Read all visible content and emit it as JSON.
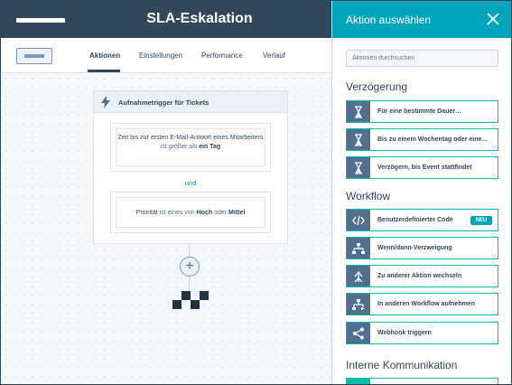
{
  "header": {
    "title": "SLA-Eskalation"
  },
  "tabs": [
    {
      "label": "Aktionen",
      "active": true
    },
    {
      "label": "Einstellungen",
      "active": false
    },
    {
      "label": "Performance",
      "active": false
    },
    {
      "label": "Verlauf",
      "active": false
    }
  ],
  "trigger": {
    "title": "Aufnahmetrigger für Tickets",
    "condition1": {
      "prefix": "Zeit bis zur ersten E-Mail-Antwort eines Mitarbeiters",
      "operator": "ist größer als",
      "value": "ein Tag"
    },
    "connector": "und",
    "condition2": {
      "prefix": "Priorität",
      "operator": "ist eines von",
      "value1": "Hoch",
      "or": "oder",
      "value2": "Mittel"
    }
  },
  "panel": {
    "title": "Aktion auswählen",
    "search_placeholder": "Aktionen durchsuchen",
    "sections": [
      {
        "title": "Verzögerung",
        "items": [
          {
            "label": "Für eine bestimmte Dauer…",
            "icon": "hourglass-icon"
          },
          {
            "label": "Bis zu einem Wochentag oder eine…",
            "icon": "hourglass-icon"
          },
          {
            "label": "Verzögern, bis Event stattfindet",
            "icon": "hourglass-icon"
          }
        ]
      },
      {
        "title": "Workflow",
        "items": [
          {
            "label": "Benutzerdefinierter Code",
            "icon": "code-icon",
            "badge": "NEU"
          },
          {
            "label": "Wenn/dann-Verzweigung",
            "icon": "branch-icon"
          },
          {
            "label": "Zu anderer Aktion wechseln",
            "icon": "goto-icon"
          },
          {
            "label": "In anderen Workflow aufnehmen",
            "icon": "enroll-icon"
          },
          {
            "label": "Webhook triggern",
            "icon": "share-icon"
          }
        ]
      },
      {
        "title": "Interne Kommunikation",
        "items": []
      }
    ]
  },
  "colors": {
    "header_dark": "#33475b",
    "panel_accent": "#00a4bd",
    "action_border": "#00bda5",
    "icon_bg": "#516f90"
  }
}
